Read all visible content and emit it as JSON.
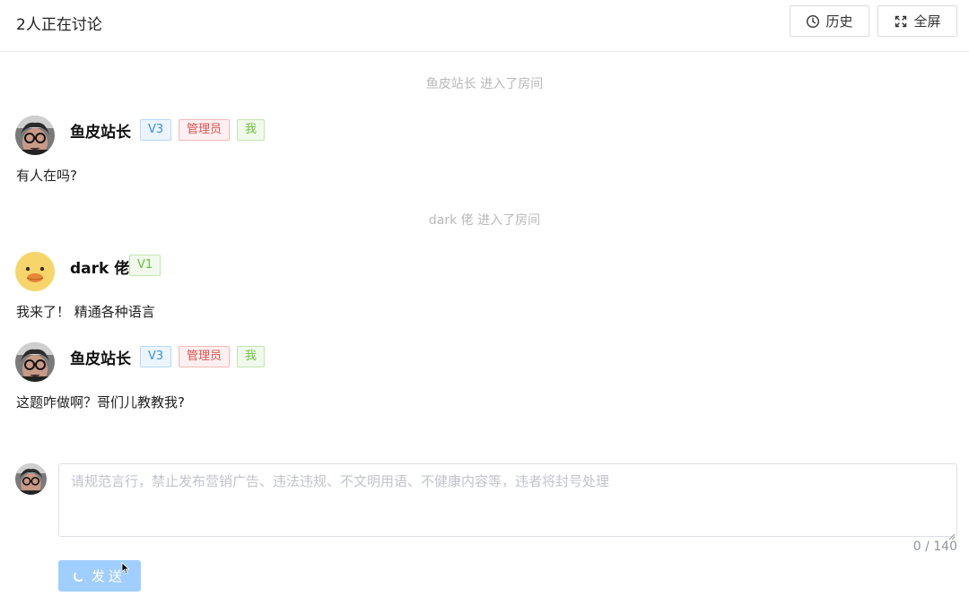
{
  "header": {
    "title": "2人正在讨论",
    "history_label": "历史",
    "fullscreen_label": "全屏"
  },
  "messages": [
    {
      "type": "system",
      "text": "鱼皮站长 进入了房间"
    },
    {
      "type": "chat",
      "user": "鱼皮站长",
      "level": "V3",
      "role": "管理员",
      "me": "我",
      "text": "有人在吗?"
    },
    {
      "type": "system",
      "text": "dark 佬 进入了房间"
    },
    {
      "type": "chat",
      "user": "dark 佬",
      "level": "V1",
      "text": "我来了！ 精通各种语言"
    },
    {
      "type": "chat",
      "user": "鱼皮站长",
      "level": "V3",
      "role": "管理员",
      "me": "我",
      "text": "这题咋做啊？哥们儿教教我?"
    }
  ],
  "composer": {
    "placeholder": "请规范言行，禁止发布营销广告、违法违规、不文明用语、不健康内容等，违者将封号处理",
    "counter": "0 / 140",
    "send_label": "发送"
  }
}
